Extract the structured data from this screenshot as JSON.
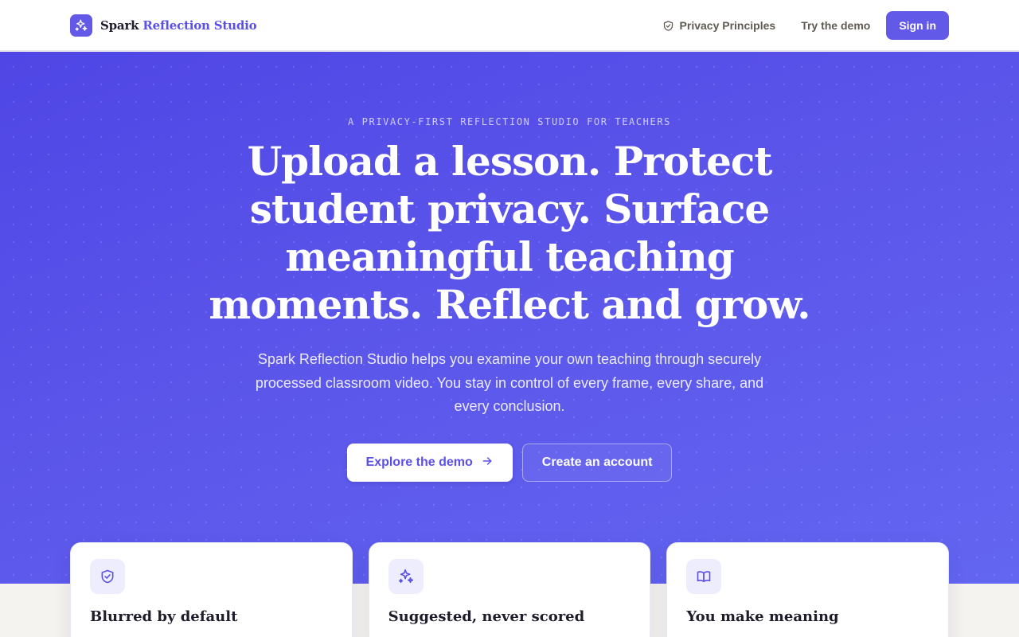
{
  "header": {
    "brand": {
      "name": "Spark",
      "accent": "Reflection Studio",
      "logo_icon": "sparkles-icon"
    },
    "nav": {
      "privacy_label": "Privacy Principles",
      "privacy_icon": "shield-check-icon",
      "demo_label": "Try the demo",
      "signin_label": "Sign in"
    }
  },
  "hero": {
    "eyebrow": "A PRIVACY-FIRST REFLECTION STUDIO FOR TEACHERS",
    "title": "Upload a lesson. Protect student privacy. Surface meaningful teaching moments. Reflect and grow.",
    "subtitle": "Spark Reflection Studio helps you examine your own teaching through securely processed classroom video. You stay in control of every frame, every share, and every conclusion.",
    "primary_cta": "Explore the demo",
    "primary_cta_icon": "arrow-right-icon",
    "secondary_cta": "Create an account"
  },
  "features": [
    {
      "title": "Blurred by default",
      "icon": "shield-check-icon"
    },
    {
      "title": "Suggested, never scored",
      "icon": "sparkles-icon"
    },
    {
      "title": "You make meaning",
      "icon": "book-open-icon"
    }
  ],
  "colors": {
    "accent": "#6359e9",
    "hero_bg": "#5a51e5",
    "page_bg": "#f5f3ef",
    "card_icon_bg": "#eeedfd"
  }
}
